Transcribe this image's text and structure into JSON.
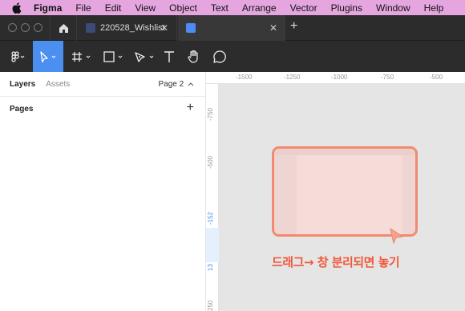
{
  "menubar": {
    "items": [
      "Figma",
      "File",
      "Edit",
      "View",
      "Object",
      "Text",
      "Arrange",
      "Vector",
      "Plugins",
      "Window",
      "Help"
    ]
  },
  "tabs": [
    {
      "label": "220528_Wishlist"
    },
    {
      "label": ""
    }
  ],
  "toolbar": {
    "tools": [
      "figma-menu-icon",
      "move-tool-icon",
      "frame-tool-icon",
      "shape-tool-icon",
      "pen-tool-icon",
      "text-tool-icon",
      "hand-tool-icon",
      "comment-tool-icon"
    ],
    "active": "move-tool-icon"
  },
  "left_panel": {
    "tab_layers": "Layers",
    "tab_assets": "Assets",
    "page_selector": "Page 2",
    "pages_title": "Pages"
  },
  "rulers": {
    "horizontal": [
      "-1500",
      "-1250",
      "-1000",
      "-750",
      "-500"
    ],
    "vertical": [
      "-750",
      "-500",
      "-152",
      "13",
      "250"
    ]
  },
  "overlay": {
    "caption": "드래그→ 창 분리되면 놓기",
    "accent_color": "#f0583a"
  }
}
